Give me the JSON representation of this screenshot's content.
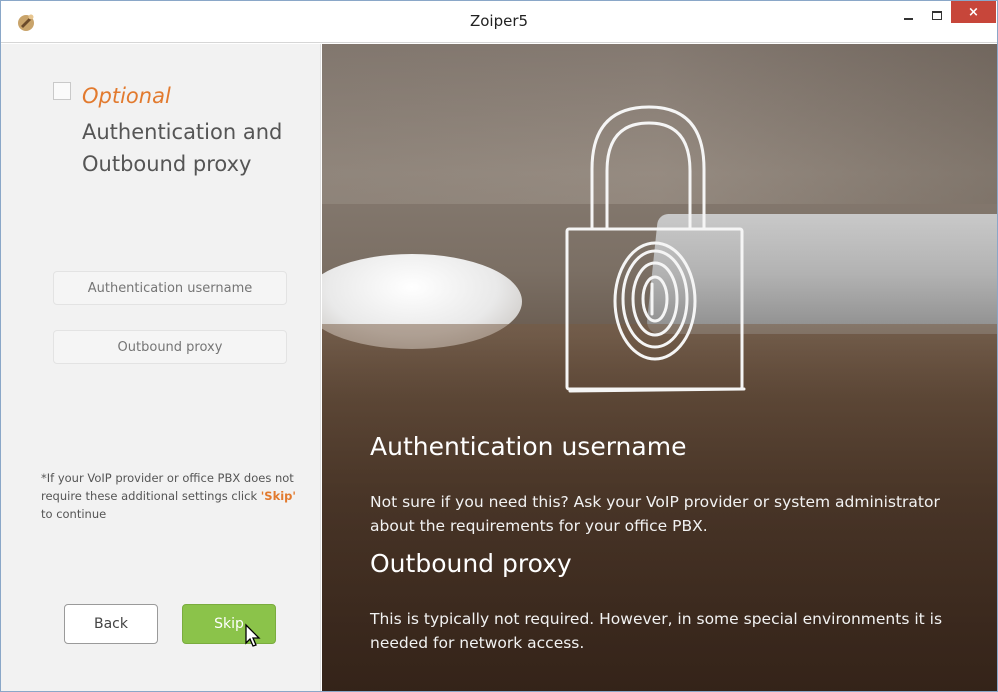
{
  "window": {
    "title": "Zoiper5",
    "close_label": "×"
  },
  "left": {
    "optional_label": "Optional",
    "heading": "Authentication and Outbound proxy",
    "fields": {
      "auth_username_placeholder": "Authentication username",
      "outbound_proxy_placeholder": "Outbound proxy"
    },
    "note_prefix": "*If your VoIP provider or office PBX does not require these additional settings click ",
    "note_emphasis": "'Skip'",
    "note_suffix": " to continue",
    "back_label": "Back",
    "skip_label": "Skip"
  },
  "info": {
    "auth_heading": "Authentication username",
    "auth_text": "Not sure if you need this? Ask your VoIP provider or system administrator about the requirements for your office PBX.",
    "proxy_heading": "Outbound proxy",
    "proxy_text": "This is typically not required. However, in some special environments it is needed for network access."
  },
  "colors": {
    "accent_orange": "#e27a2e",
    "skip_green": "#8bc34a",
    "close_red": "#c7463a"
  },
  "icons": [
    "zoiper-app-icon",
    "minimize-icon",
    "maximize-icon",
    "close-icon",
    "padlock-fingerprint-icon",
    "mouse-cursor-icon"
  ]
}
